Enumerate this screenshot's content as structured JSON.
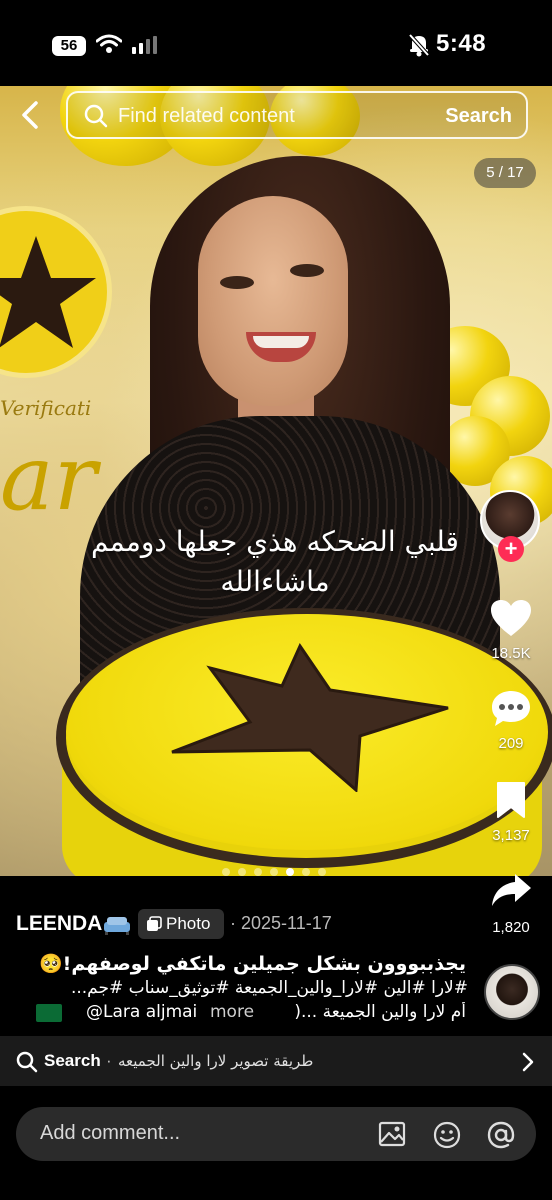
{
  "status_bar": {
    "network_badge": "56",
    "time": "5:48",
    "icons": [
      "wifi-icon",
      "signal-icon",
      "mute-bell-icon"
    ]
  },
  "search": {
    "placeholder": "Find related content",
    "button_label": "Search"
  },
  "photo": {
    "counter": "5 / 17",
    "caption_line1": "قلبي الضحكه هذي جعلها دوممم",
    "caption_line2": "ماشاءالله",
    "background_text_1": "Verificati",
    "background_text_2": "ar",
    "carousel_total_dots": 7,
    "carousel_active_index": 4
  },
  "actions": {
    "likes": "18.5K",
    "comments": "209",
    "saves": "3,137",
    "shares": "1,820"
  },
  "post": {
    "author": "LEENDA",
    "type_label": "Photo",
    "date": "· 2025-11-17",
    "desc_line1": "يجذببووون بشكل جميلين ماتكفي لوصفهم!🥺",
    "desc_line2": "#لارا #الين #لارا_والين_الجميعة #توثيق_سناب #جم...",
    "desc_mention": "@Lara aljmai",
    "desc_more": "more",
    "desc_tail": "أم لارا  والين الجميعة ...(",
    "flag": "saudi-flag"
  },
  "related": {
    "label": "Search",
    "separator": "·",
    "term": "طريقة تصوير لارا والين الجميعه"
  },
  "comment": {
    "placeholder": "Add comment..."
  },
  "colors": {
    "accent_red": "#fe2c55",
    "cake_yellow": "#f0d90b",
    "background": "#000000"
  }
}
